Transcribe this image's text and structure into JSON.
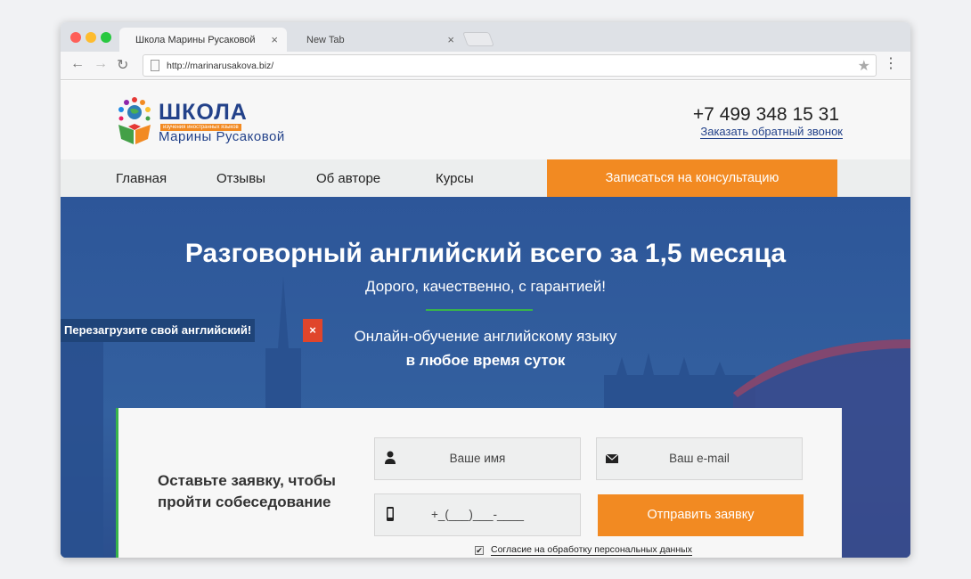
{
  "browser": {
    "tabs": [
      {
        "title": "Школа Марины Русаковой",
        "close": "×"
      },
      {
        "title": "New Tab",
        "close": "×"
      }
    ],
    "url": "http://marinarusakova.biz/"
  },
  "header": {
    "logo_title": "ШКОЛА",
    "logo_tagline": "изучения иностранных языков",
    "logo_subtitle": "Марины Русаковой",
    "phone": "+7 499 348 15 31",
    "callback_link": "Заказать обратный звонок"
  },
  "nav": {
    "items": [
      "Главная",
      "Отзывы",
      "Об авторе",
      "Курсы"
    ],
    "cta": "Записаться на консультацию"
  },
  "hero": {
    "headline": "Разговорный английский всего за 1,5 месяца",
    "subheadline": "Дорого, качественно, с гарантией!",
    "line1": "Онлайн-обучение английскому языку",
    "line2": "в любое время суток",
    "promo_label": "Перезагрузите свой английский!",
    "promo_close": "×"
  },
  "form": {
    "title": "Оставьте заявку, чтобы пройти собеседование",
    "name_placeholder": "Ваше имя",
    "email_placeholder": "Ваш e-mail",
    "phone_placeholder": "+_(___)___-____",
    "submit": "Отправить заявку",
    "consent": "Согласие на обработку персональных данных"
  },
  "colors": {
    "brand_blue": "#23428a",
    "accent_orange": "#f28a22",
    "hero_blue": "#2f5a9d",
    "accent_green": "#38b44a"
  }
}
